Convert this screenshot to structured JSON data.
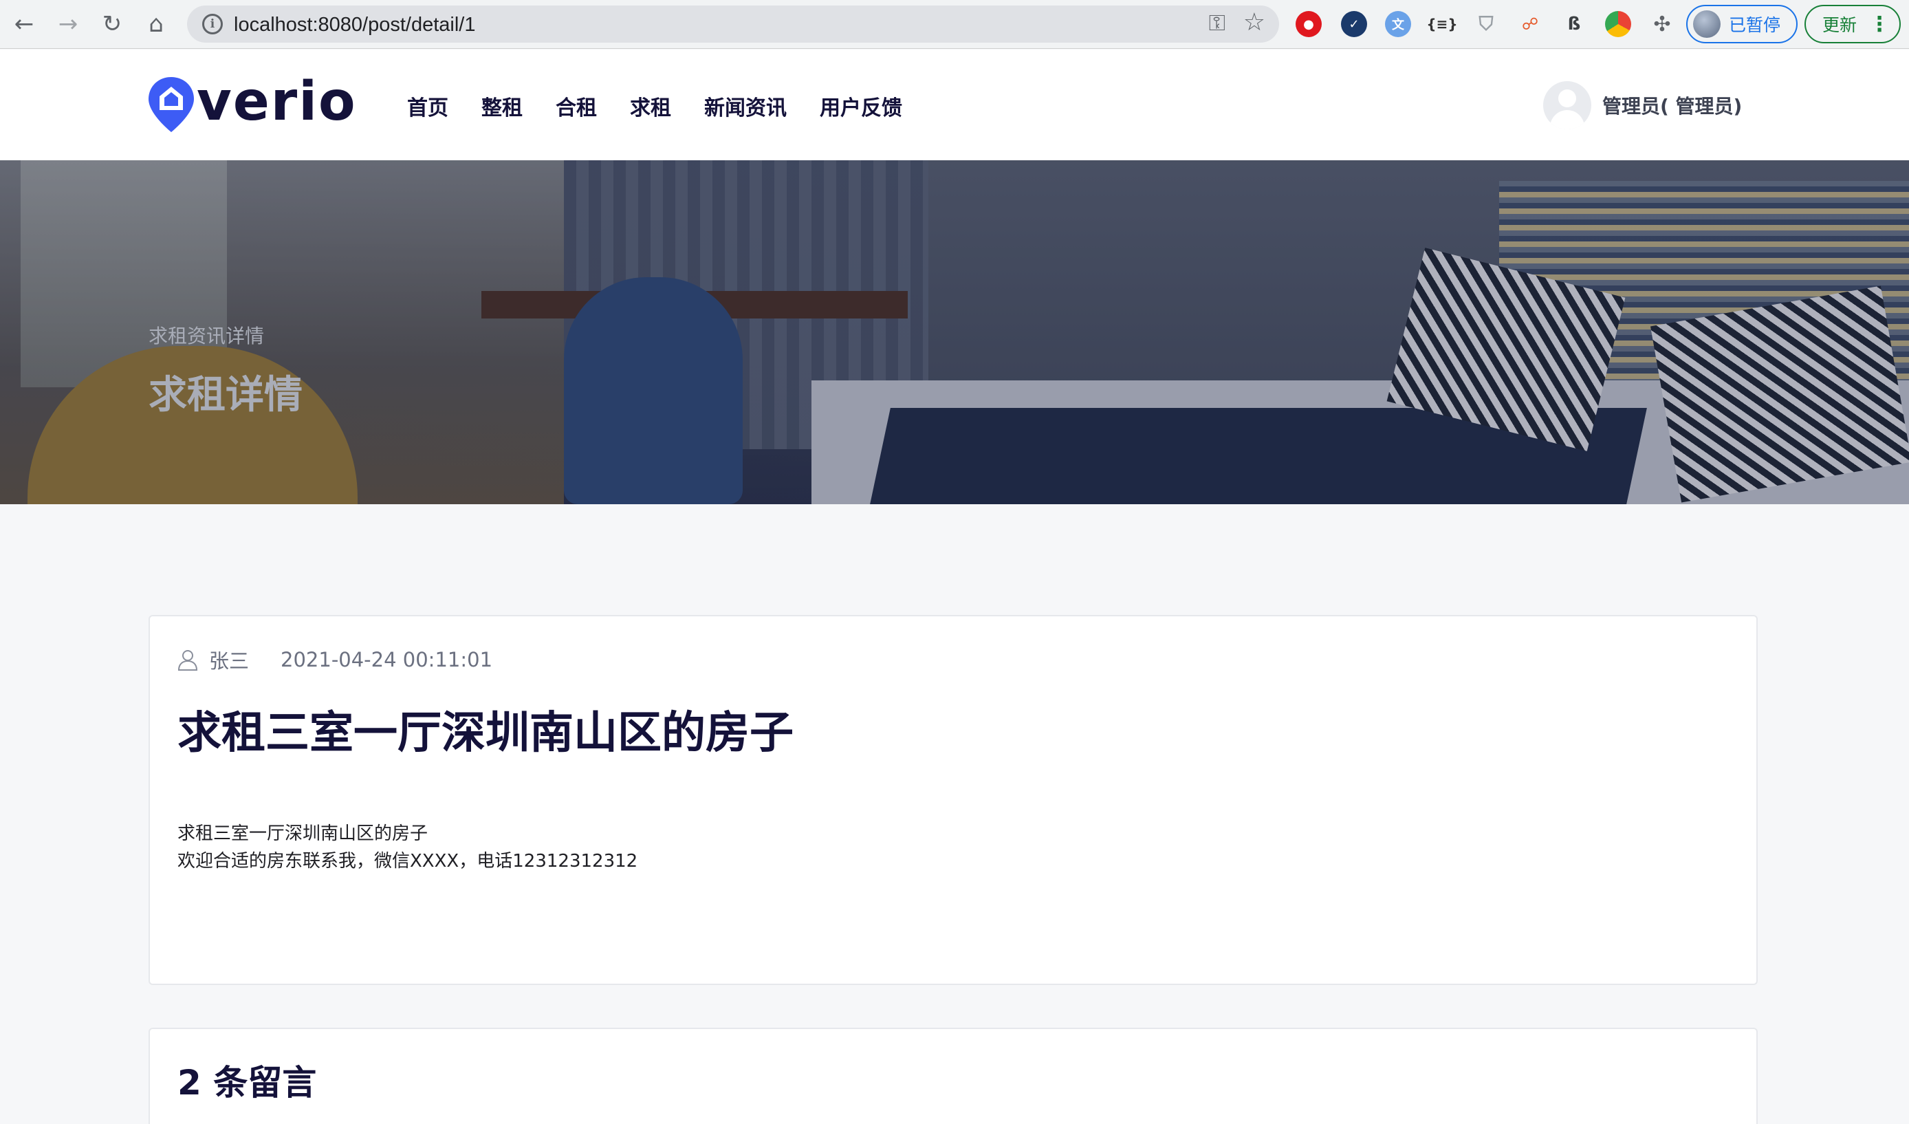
{
  "browser": {
    "url": "localhost:8080/post/detail/1",
    "profile_label": "已暂停",
    "update_label": "更新"
  },
  "site": {
    "logo_text": "verio",
    "nav": [
      {
        "label": "首页"
      },
      {
        "label": "整租"
      },
      {
        "label": "合租"
      },
      {
        "label": "求租"
      },
      {
        "label": "新闻资讯"
      },
      {
        "label": "用户反馈"
      }
    ],
    "user_name": "管理员( 管理员)"
  },
  "hero": {
    "breadcrumb": "求租资讯详情",
    "title": "求租详情"
  },
  "post": {
    "author": "张三",
    "date": "2021-04-24 00:11:01",
    "title": "求租三室一厅深圳南山区的房子",
    "body_line1": "求租三室一厅深圳南山区的房子",
    "body_line2": "欢迎合适的房东联系我，微信XXXX，电话12312312312"
  },
  "comments": {
    "heading": "2 条留言"
  },
  "colors": {
    "brand": "#3d5cf5",
    "heading": "#14123a"
  }
}
